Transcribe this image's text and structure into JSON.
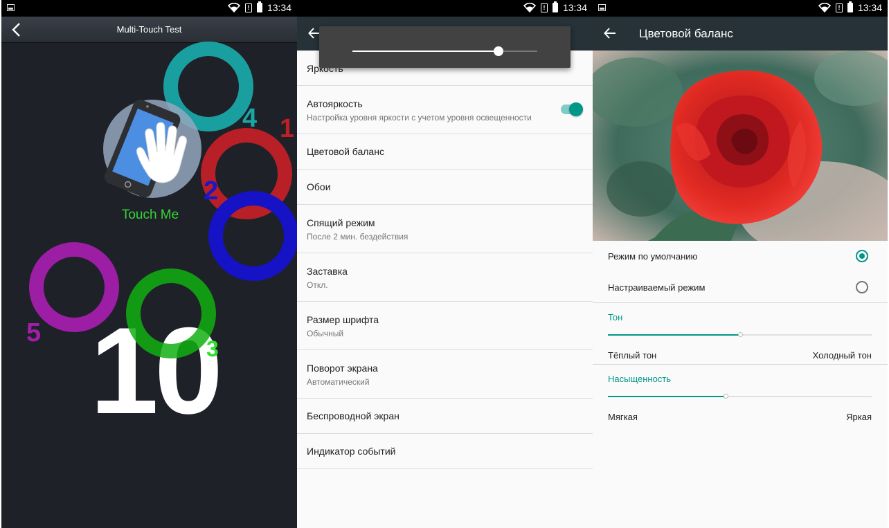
{
  "status_bar": {
    "time": "13:34"
  },
  "multitouch": {
    "title": "Multi-Touch Test",
    "touch_label": "Touch Me",
    "count": "10",
    "touch_numbers": [
      "1",
      "2",
      "3",
      "4",
      "5"
    ],
    "colors": {
      "teal": "#1aa7a7",
      "red": "#c01f26",
      "blue": "#1a17c8",
      "purple": "#a11fa8",
      "green": "#12a312",
      "label_green": "#36d536"
    }
  },
  "display_settings": {
    "brightness_level": 0.79,
    "items": [
      {
        "title": "Яркость"
      },
      {
        "title": "Автояркость",
        "subtitle": "Настройка уровня яркости с учетом уровня освещенности",
        "toggle_on": true
      },
      {
        "title": "Цветовой баланс"
      },
      {
        "title": "Обои"
      },
      {
        "title": "Спящий режим",
        "subtitle": "После 2 мин. бездействия"
      },
      {
        "title": "Заставка",
        "subtitle": "Откл."
      },
      {
        "title": "Размер шрифта",
        "subtitle": "Обычный"
      },
      {
        "title": "Поворот экрана",
        "subtitle": "Автоматический"
      },
      {
        "title": "Беспроводной экран"
      },
      {
        "title": "Индикатор событий"
      }
    ]
  },
  "color_balance": {
    "title": "Цветовой баланс",
    "modes": [
      {
        "label": "Режим по умолчанию",
        "selected": true
      },
      {
        "label": "Настраиваемый режим",
        "selected": false
      }
    ],
    "tone": {
      "title": "Тон",
      "left_label": "Тёплый тон",
      "right_label": "Холодный тон",
      "value": 0.5
    },
    "saturation": {
      "title": "Насыщенность",
      "left_label": "Мягкая",
      "right_label": "Яркая",
      "value": 0.445
    },
    "accent_color": "#009688"
  }
}
